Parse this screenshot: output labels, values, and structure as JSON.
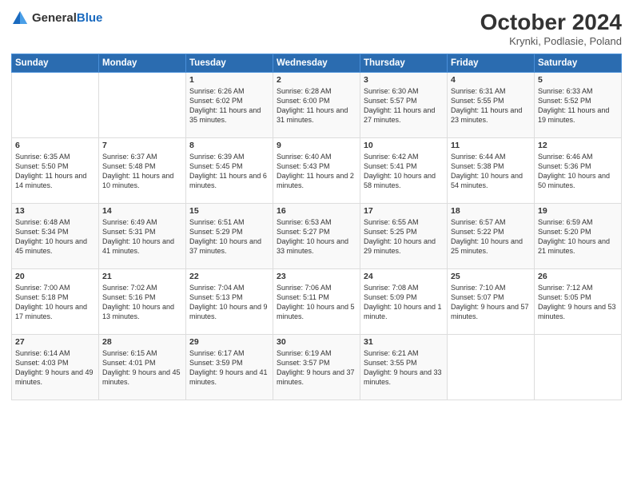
{
  "header": {
    "logo_general": "General",
    "logo_blue": "Blue",
    "month_title": "October 2024",
    "location": "Krynki, Podlasie, Poland"
  },
  "weekdays": [
    "Sunday",
    "Monday",
    "Tuesday",
    "Wednesday",
    "Thursday",
    "Friday",
    "Saturday"
  ],
  "weeks": [
    [
      {
        "day": "",
        "content": ""
      },
      {
        "day": "",
        "content": ""
      },
      {
        "day": "1",
        "content": "Sunrise: 6:26 AM\nSunset: 6:02 PM\nDaylight: 11 hours and 35 minutes."
      },
      {
        "day": "2",
        "content": "Sunrise: 6:28 AM\nSunset: 6:00 PM\nDaylight: 11 hours and 31 minutes."
      },
      {
        "day": "3",
        "content": "Sunrise: 6:30 AM\nSunset: 5:57 PM\nDaylight: 11 hours and 27 minutes."
      },
      {
        "day": "4",
        "content": "Sunrise: 6:31 AM\nSunset: 5:55 PM\nDaylight: 11 hours and 23 minutes."
      },
      {
        "day": "5",
        "content": "Sunrise: 6:33 AM\nSunset: 5:52 PM\nDaylight: 11 hours and 19 minutes."
      }
    ],
    [
      {
        "day": "6",
        "content": "Sunrise: 6:35 AM\nSunset: 5:50 PM\nDaylight: 11 hours and 14 minutes."
      },
      {
        "day": "7",
        "content": "Sunrise: 6:37 AM\nSunset: 5:48 PM\nDaylight: 11 hours and 10 minutes."
      },
      {
        "day": "8",
        "content": "Sunrise: 6:39 AM\nSunset: 5:45 PM\nDaylight: 11 hours and 6 minutes."
      },
      {
        "day": "9",
        "content": "Sunrise: 6:40 AM\nSunset: 5:43 PM\nDaylight: 11 hours and 2 minutes."
      },
      {
        "day": "10",
        "content": "Sunrise: 6:42 AM\nSunset: 5:41 PM\nDaylight: 10 hours and 58 minutes."
      },
      {
        "day": "11",
        "content": "Sunrise: 6:44 AM\nSunset: 5:38 PM\nDaylight: 10 hours and 54 minutes."
      },
      {
        "day": "12",
        "content": "Sunrise: 6:46 AM\nSunset: 5:36 PM\nDaylight: 10 hours and 50 minutes."
      }
    ],
    [
      {
        "day": "13",
        "content": "Sunrise: 6:48 AM\nSunset: 5:34 PM\nDaylight: 10 hours and 45 minutes."
      },
      {
        "day": "14",
        "content": "Sunrise: 6:49 AM\nSunset: 5:31 PM\nDaylight: 10 hours and 41 minutes."
      },
      {
        "day": "15",
        "content": "Sunrise: 6:51 AM\nSunset: 5:29 PM\nDaylight: 10 hours and 37 minutes."
      },
      {
        "day": "16",
        "content": "Sunrise: 6:53 AM\nSunset: 5:27 PM\nDaylight: 10 hours and 33 minutes."
      },
      {
        "day": "17",
        "content": "Sunrise: 6:55 AM\nSunset: 5:25 PM\nDaylight: 10 hours and 29 minutes."
      },
      {
        "day": "18",
        "content": "Sunrise: 6:57 AM\nSunset: 5:22 PM\nDaylight: 10 hours and 25 minutes."
      },
      {
        "day": "19",
        "content": "Sunrise: 6:59 AM\nSunset: 5:20 PM\nDaylight: 10 hours and 21 minutes."
      }
    ],
    [
      {
        "day": "20",
        "content": "Sunrise: 7:00 AM\nSunset: 5:18 PM\nDaylight: 10 hours and 17 minutes."
      },
      {
        "day": "21",
        "content": "Sunrise: 7:02 AM\nSunset: 5:16 PM\nDaylight: 10 hours and 13 minutes."
      },
      {
        "day": "22",
        "content": "Sunrise: 7:04 AM\nSunset: 5:13 PM\nDaylight: 10 hours and 9 minutes."
      },
      {
        "day": "23",
        "content": "Sunrise: 7:06 AM\nSunset: 5:11 PM\nDaylight: 10 hours and 5 minutes."
      },
      {
        "day": "24",
        "content": "Sunrise: 7:08 AM\nSunset: 5:09 PM\nDaylight: 10 hours and 1 minute."
      },
      {
        "day": "25",
        "content": "Sunrise: 7:10 AM\nSunset: 5:07 PM\nDaylight: 9 hours and 57 minutes."
      },
      {
        "day": "26",
        "content": "Sunrise: 7:12 AM\nSunset: 5:05 PM\nDaylight: 9 hours and 53 minutes."
      }
    ],
    [
      {
        "day": "27",
        "content": "Sunrise: 6:14 AM\nSunset: 4:03 PM\nDaylight: 9 hours and 49 minutes."
      },
      {
        "day": "28",
        "content": "Sunrise: 6:15 AM\nSunset: 4:01 PM\nDaylight: 9 hours and 45 minutes."
      },
      {
        "day": "29",
        "content": "Sunrise: 6:17 AM\nSunset: 3:59 PM\nDaylight: 9 hours and 41 minutes."
      },
      {
        "day": "30",
        "content": "Sunrise: 6:19 AM\nSunset: 3:57 PM\nDaylight: 9 hours and 37 minutes."
      },
      {
        "day": "31",
        "content": "Sunrise: 6:21 AM\nSunset: 3:55 PM\nDaylight: 9 hours and 33 minutes."
      },
      {
        "day": "",
        "content": ""
      },
      {
        "day": "",
        "content": ""
      }
    ]
  ]
}
